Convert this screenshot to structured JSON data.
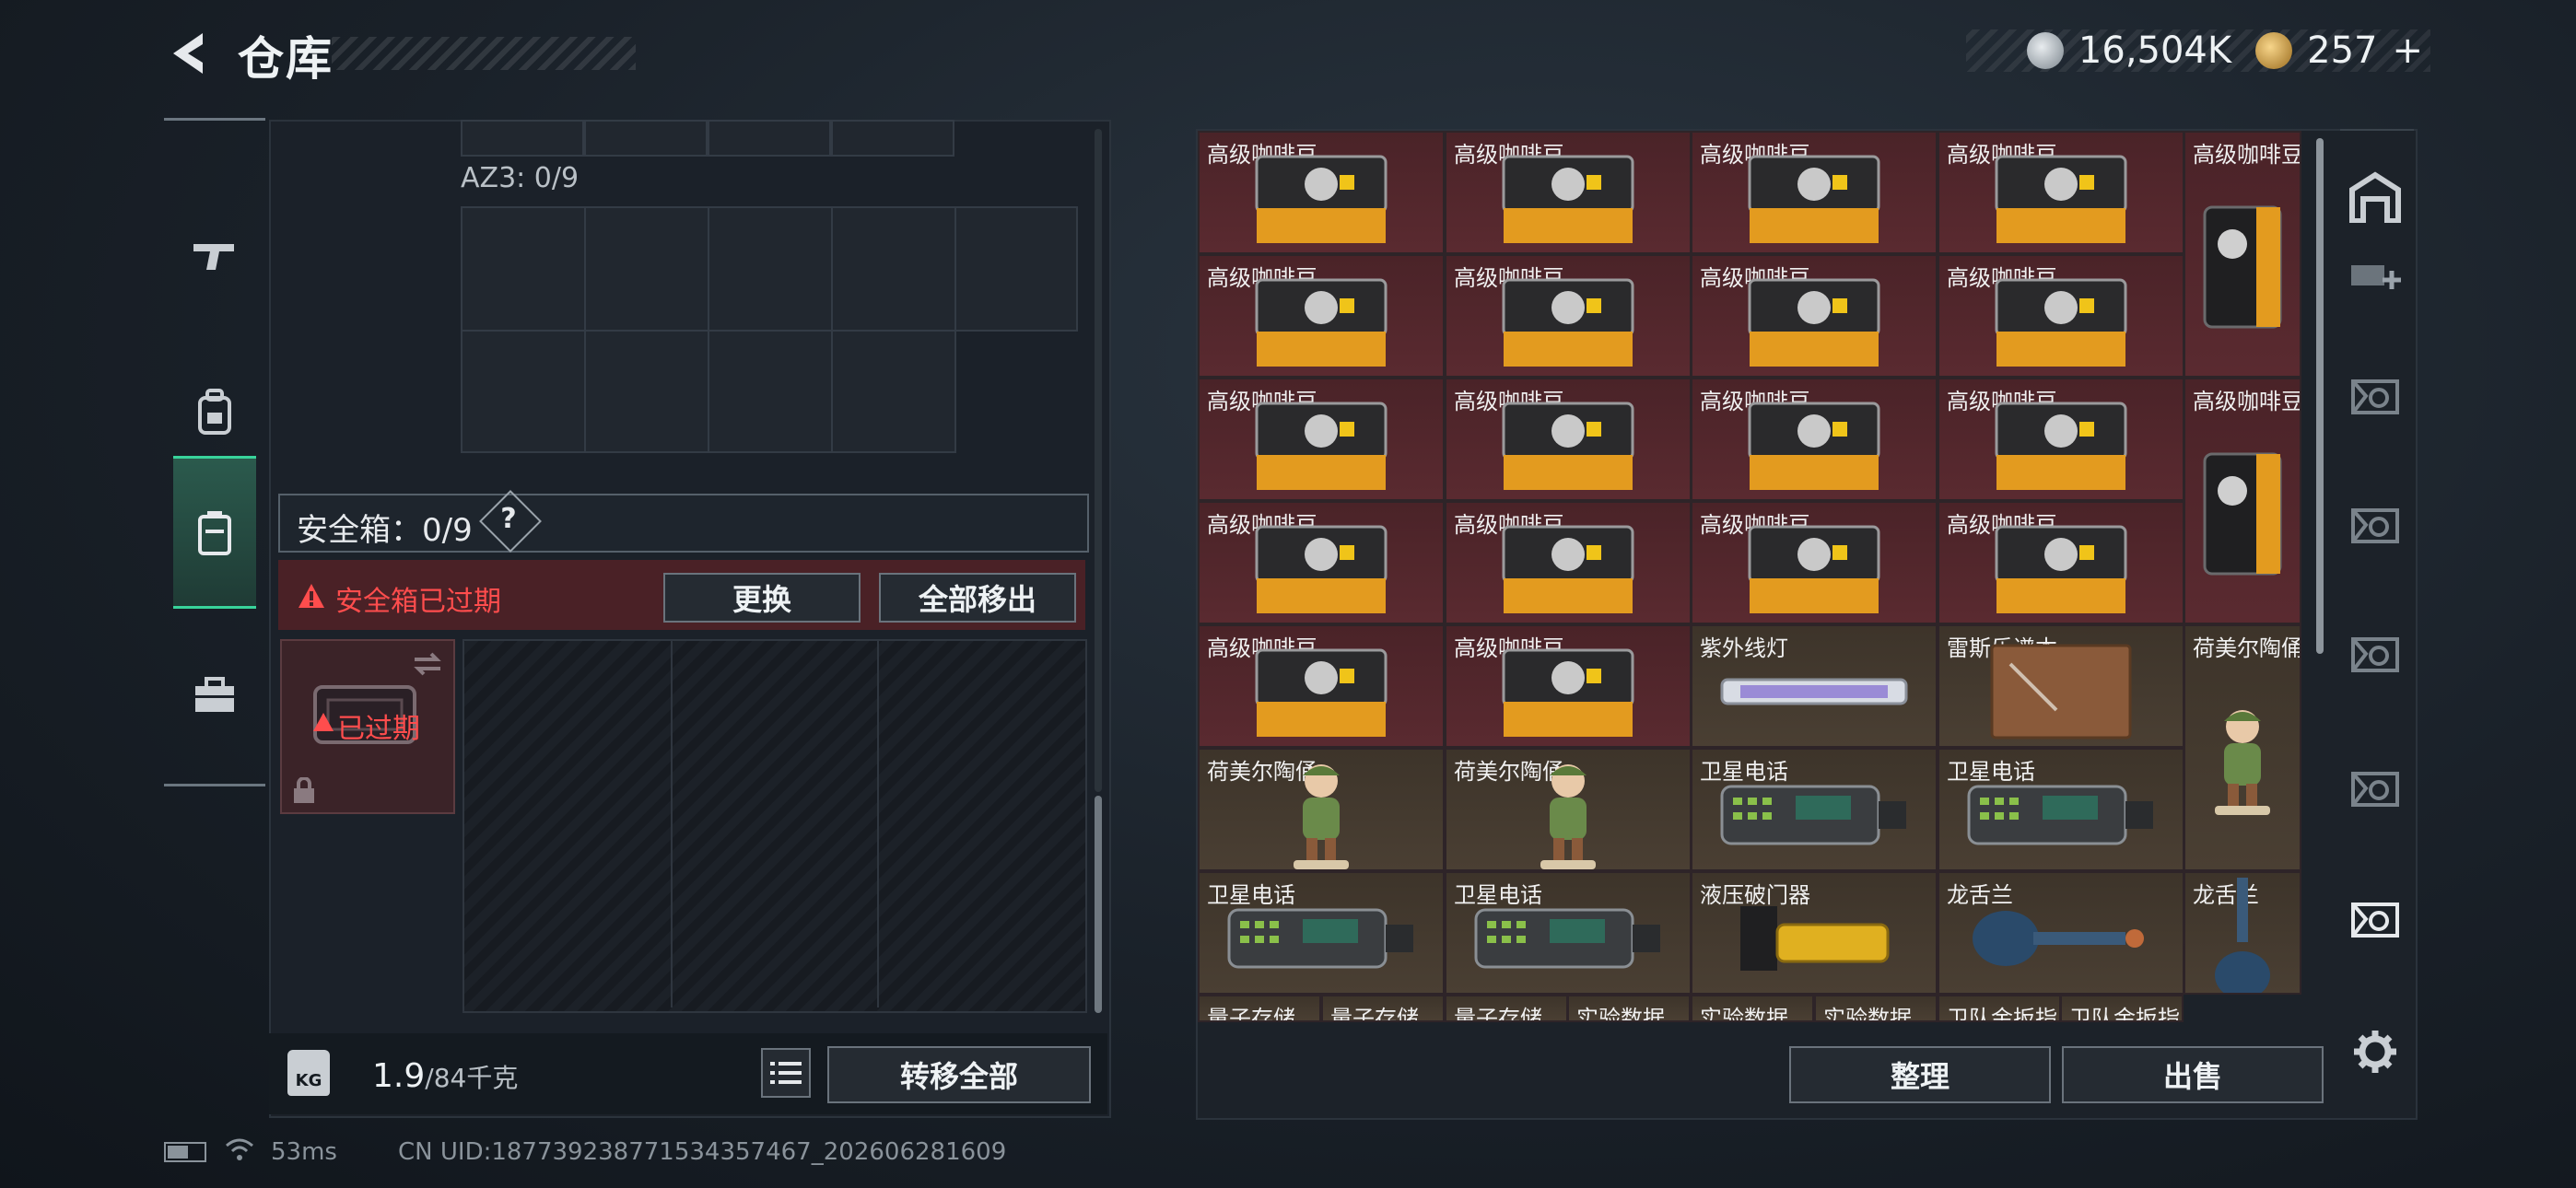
{
  "header": {
    "title": "仓库",
    "currency": [
      {
        "icon": "silver-coin-icon",
        "value": "16,504K"
      },
      {
        "icon": "gold-coin-icon",
        "value": "257"
      },
      {
        "add_label": "+"
      }
    ]
  },
  "left_panel": {
    "az3_label": "AZ3: 0/9",
    "safebox_label": "安全箱：0/9",
    "safebox_help": "?",
    "warning_text": "安全箱已过期",
    "replace_button": "更换",
    "move_all_out_button": "全部移出",
    "expired_badge": "已过期",
    "weight_value": "1.9",
    "weight_max": "/84千克",
    "weight_icon_text": "KG",
    "transfer_all_button": "转移全部"
  },
  "inventory": {
    "items": [
      {
        "name": "高级咖啡豆",
        "kind": "coffee-bag",
        "color": "red"
      },
      {
        "name": "高级咖啡豆",
        "kind": "coffee-bag",
        "color": "red"
      },
      {
        "name": "高级咖啡豆",
        "kind": "coffee-bag",
        "color": "red"
      },
      {
        "name": "高级咖啡豆",
        "kind": "coffee-bag",
        "color": "red"
      },
      {
        "name": "高级咖啡豆",
        "kind": "coffee-tall",
        "color": "red"
      },
      {
        "name": "高级咖啡豆",
        "kind": "coffee-bag",
        "color": "red"
      },
      {
        "name": "高级咖啡豆",
        "kind": "coffee-bag",
        "color": "red"
      },
      {
        "name": "高级咖啡豆",
        "kind": "coffee-bag",
        "color": "red"
      },
      {
        "name": "高级咖啡豆",
        "kind": "coffee-bag",
        "color": "red"
      },
      {
        "name": "高级咖啡豆",
        "kind": "coffee-bag",
        "color": "red"
      },
      {
        "name": "高级咖啡豆",
        "kind": "coffee-bag",
        "color": "red"
      },
      {
        "name": "高级咖啡豆",
        "kind": "coffee-bag",
        "color": "red"
      },
      {
        "name": "高级咖啡豆",
        "kind": "coffee-bag",
        "color": "red"
      },
      {
        "name": "高级咖啡豆",
        "kind": "coffee-tall",
        "color": "red"
      },
      {
        "name": "高级咖啡豆",
        "kind": "coffee-bag",
        "color": "red"
      },
      {
        "name": "高级咖啡豆",
        "kind": "coffee-bag",
        "color": "red"
      },
      {
        "name": "高级咖啡豆",
        "kind": "coffee-bag",
        "color": "red"
      },
      {
        "name": "高级咖啡豆",
        "kind": "coffee-bag",
        "color": "red"
      },
      {
        "name": "高级咖啡豆",
        "kind": "coffee-bag",
        "color": "red"
      },
      {
        "name": "高级咖啡豆",
        "kind": "coffee-bag",
        "color": "red"
      },
      {
        "name": "紫外线灯",
        "kind": "uv-lamp",
        "color": "brown"
      },
      {
        "name": "雷斯乐谱本",
        "kind": "notebook",
        "color": "brown"
      },
      {
        "name": "荷美尔陶俑",
        "kind": "figurine-tall",
        "color": "brown"
      },
      {
        "name": "荷美尔陶俑",
        "kind": "figurine",
        "color": "brown"
      },
      {
        "name": "荷美尔陶俑",
        "kind": "figurine",
        "color": "brown"
      },
      {
        "name": "卫星电话",
        "kind": "sat-phone",
        "color": "brown"
      },
      {
        "name": "卫星电话",
        "kind": "sat-phone",
        "color": "brown"
      },
      {
        "name": "卫星电话",
        "kind": "sat-phone",
        "color": "brown"
      },
      {
        "name": "卫星电话",
        "kind": "sat-phone",
        "color": "brown"
      },
      {
        "name": "液压破门器",
        "kind": "breacher",
        "color": "brown"
      },
      {
        "name": "龙舌兰",
        "kind": "tequila",
        "color": "brown"
      },
      {
        "name": "龙舌兰",
        "kind": "tequila-tall",
        "color": "brown"
      },
      {
        "name": "量子存储",
        "kind": "partial",
        "color": "brown"
      },
      {
        "name": "量子存储",
        "kind": "partial",
        "color": "brown"
      },
      {
        "name": "量子存储",
        "kind": "partial",
        "color": "brown"
      },
      {
        "name": "实验数据",
        "kind": "partial",
        "color": "brown"
      },
      {
        "name": "实验数据",
        "kind": "partial",
        "color": "brown"
      },
      {
        "name": "实验数据",
        "kind": "partial",
        "color": "brown"
      },
      {
        "name": "卫队金扳指",
        "kind": "partial",
        "color": "brown"
      },
      {
        "name": "卫队金扳指",
        "kind": "partial",
        "color": "brown"
      }
    ],
    "sort_button": "整理",
    "sell_button": "出售"
  },
  "status_bar": {
    "ping": "53ms",
    "uid": "CN UID:18773923877153435746​7_202606281609"
  },
  "colors": {
    "accent_green": "#38d39b",
    "warn_red": "#ff4d4d",
    "rare_red_bg": "#4a2328",
    "common_brown_bg": "#3d342a"
  }
}
